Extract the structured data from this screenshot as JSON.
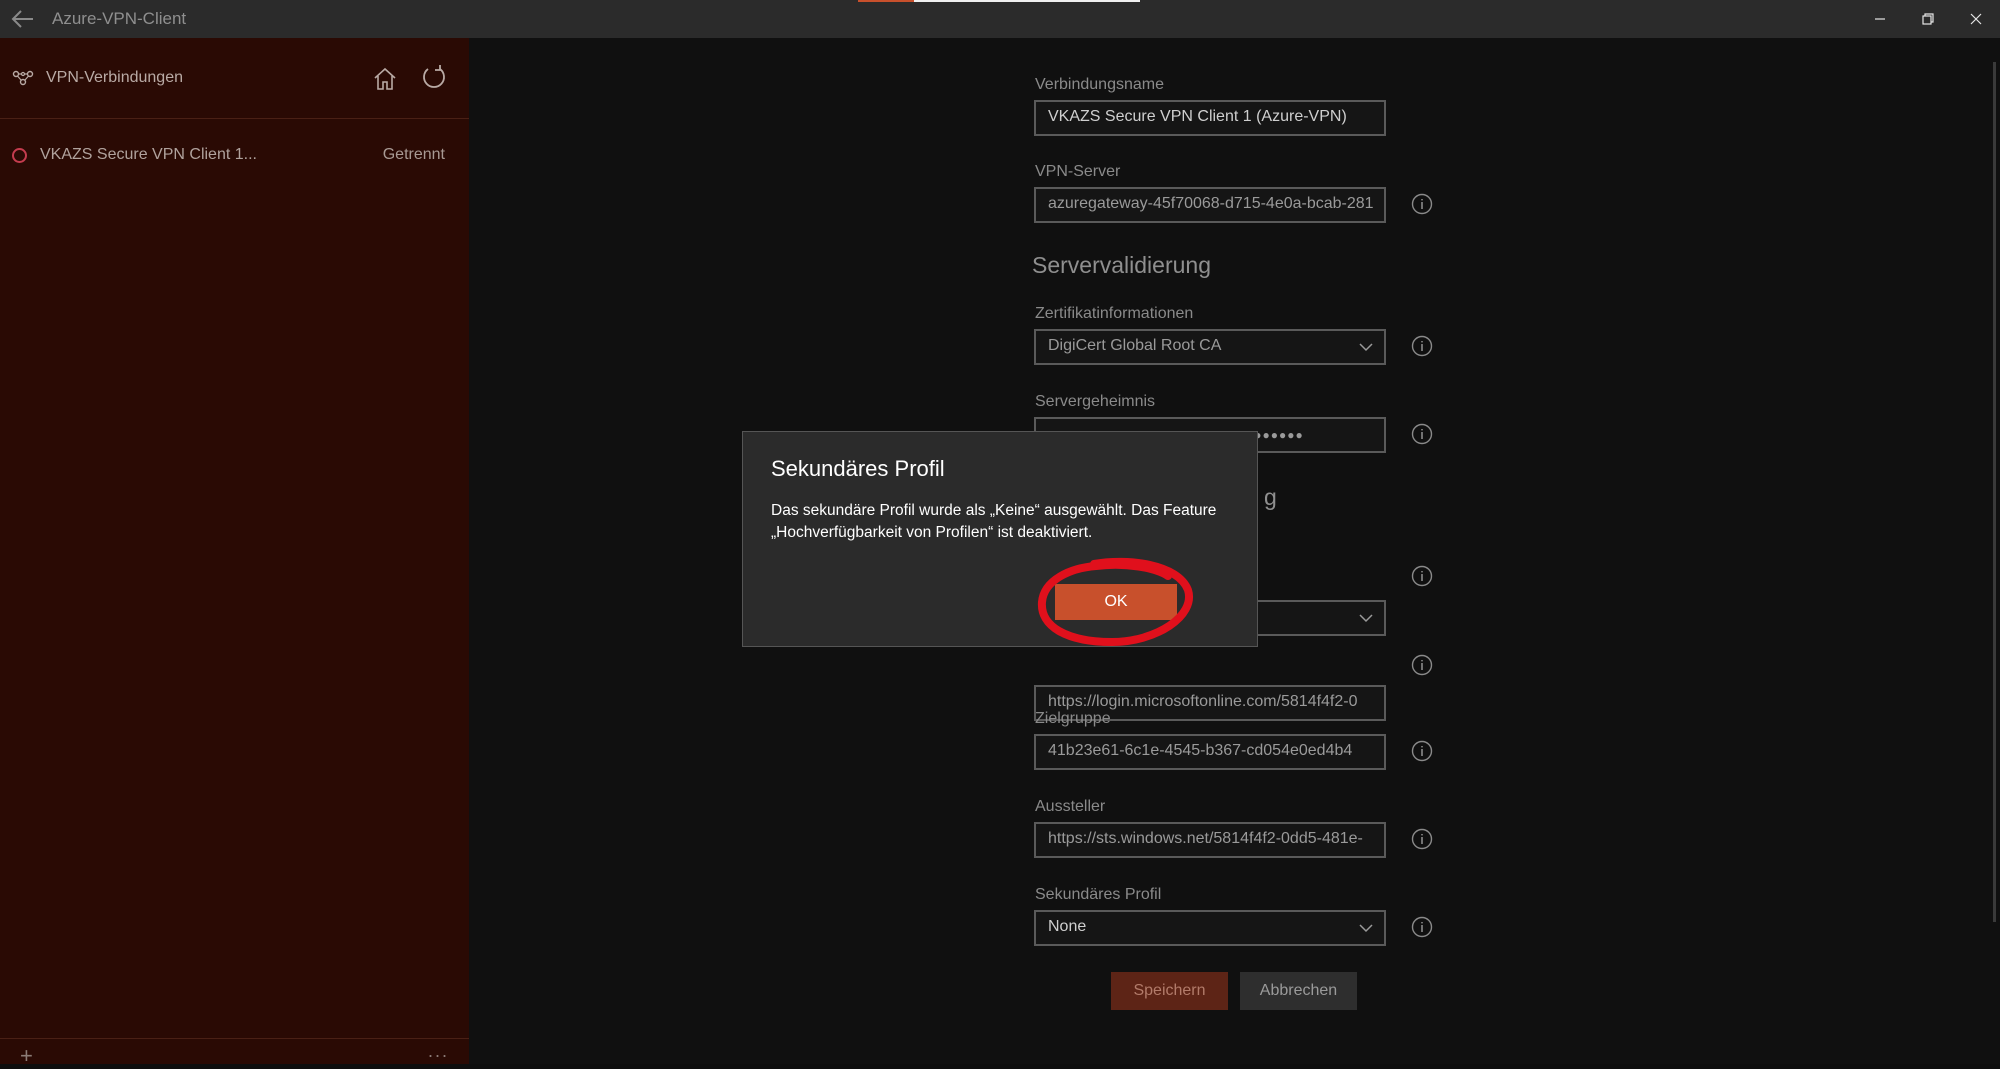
{
  "window": {
    "title": "Azure-VPN-Client",
    "back_icon": "back-arrow-icon",
    "minimize_icon": "minimize-icon",
    "restore_icon": "restore-icon",
    "close_icon": "close-icon"
  },
  "sidebar": {
    "header_label": "VPN-Verbindungen",
    "connections": [
      {
        "name": "VKAZS Secure VPN Client 1...",
        "status": "Getrennt",
        "status_color": "#c43c4e"
      }
    ],
    "footer_add": "+",
    "footer_more": "..."
  },
  "form": {
    "connection_name_label": "Verbindungsname",
    "connection_name_value": "VKAZS Secure VPN Client 1 (Azure-VPN)",
    "vpn_server_label": "VPN-Server",
    "vpn_server_value": "azuregateway-45f70068-d715-4e0a-bcab-281",
    "server_validation_title": "Servervalidierung",
    "cert_info_label": "Zertifikatinformationen",
    "cert_info_value": "DigiCert Global Root CA",
    "server_secret_label": "Servergeheimnis",
    "server_secret_value": "●●●●●●●●●●●●●●●●●●●●●●●●●●●●●●●",
    "partial_section_title_tail": "g",
    "tenant_value": "https://login.microsoftonline.com/5814f4f2-0",
    "audience_label": "Zielgruppe",
    "audience_value": "41b23e61-6c1e-4545-b367-cd054e0ed4b4",
    "issuer_label": "Aussteller",
    "issuer_value": "https://sts.windows.net/5814f4f2-0dd5-481e-",
    "secondary_profile_label": "Sekundäres Profil",
    "secondary_profile_value": "None",
    "save_label": "Speichern",
    "cancel_label": "Abbrechen"
  },
  "dialog": {
    "title": "Sekundäres Profil",
    "body": "Das sekundäre Profil wurde als „Keine“ ausgewählt. Das Feature „Hochverfügbarkeit von Profilen“ ist deaktiviert.",
    "ok_label": "OK",
    "accent_color": "#c8502c",
    "annotation_color": "#e0101c"
  }
}
